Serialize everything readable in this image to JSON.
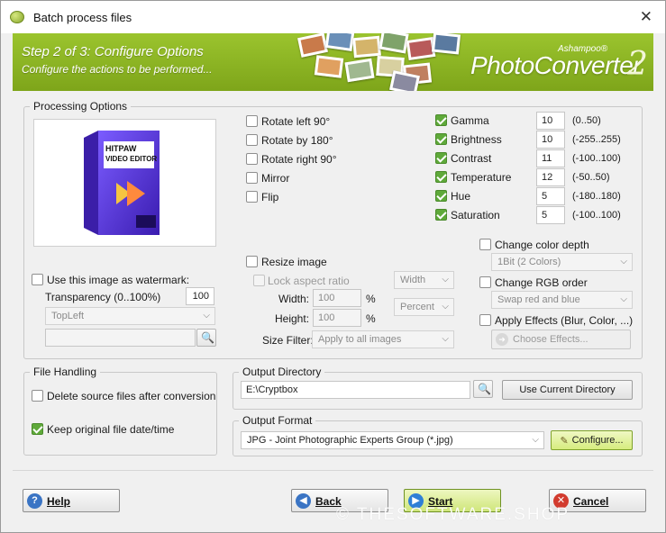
{
  "window": {
    "title": "Batch process files"
  },
  "banner": {
    "step": "Step 2 of 3: Configure Options",
    "subtitle": "Configure the actions to be performed...",
    "brand_small": "Ashampoo®",
    "brand_big": "PhotoConverter",
    "brand_num": "2"
  },
  "processing": {
    "legend": "Processing Options",
    "preview_product": {
      "line1": "HITPAW",
      "line2": "VIDEO EDITOR"
    },
    "watermark_label": "Use this image as watermark:",
    "transparency_label": "Transparency (0..100%)",
    "transparency_value": "100",
    "position_select": "TopLeft",
    "watermark_path": "",
    "rotate_left": "Rotate left 90°",
    "rotate_180": "Rotate by 180°",
    "rotate_right": "Rotate right 90°",
    "mirror": "Mirror",
    "flip": "Flip",
    "resize_label": "Resize image",
    "lock_aspect": "Lock aspect ratio",
    "dimension_select": "Width",
    "width_label": "Width:",
    "width_value": "100",
    "height_label": "Height:",
    "height_value": "100",
    "percent_sign": "%",
    "unit_select": "Percent",
    "size_filter_label": "Size Filter:",
    "size_filter_select": "Apply to all images",
    "adjustments": [
      {
        "label": "Gamma",
        "value": "10",
        "range": "(0..50)"
      },
      {
        "label": "Brightness",
        "value": "10",
        "range": "(-255..255)"
      },
      {
        "label": "Contrast",
        "value": "11",
        "range": "(-100..100)"
      },
      {
        "label": "Temperature",
        "value": "12",
        "range": "(-50..50)"
      },
      {
        "label": "Hue",
        "value": "5",
        "range": "(-180..180)"
      },
      {
        "label": "Saturation",
        "value": "5",
        "range": "(-100..100)"
      }
    ],
    "color_depth_label": "Change color depth",
    "color_depth_select": "1Bit (2 Colors)",
    "rgb_order_label": "Change RGB order",
    "rgb_order_select": "Swap red and blue",
    "effects_label": "Apply Effects (Blur, Color, ...)",
    "choose_effects": "Choose Effects..."
  },
  "file_handling": {
    "legend": "File Handling",
    "delete_source": "Delete source files after conversion",
    "keep_date": "Keep original file date/time"
  },
  "output_directory": {
    "legend": "Output Directory",
    "path": "E:\\Cryptbox",
    "use_current": "Use Current Directory"
  },
  "output_format": {
    "legend": "Output Format",
    "format": "JPG - Joint Photographic Experts Group (*.jpg)",
    "configure": "Configure..."
  },
  "footer": {
    "help": "Help",
    "back": "Back",
    "start": "Start",
    "cancel": "Cancel",
    "watermark_text": "© THESOFTWARE.SHOP"
  },
  "colors": {
    "accent_green": "#8ab426",
    "check_green": "#5fa93a",
    "help_blue": "#3a74c4",
    "back_blue": "#3a74c4",
    "start_blue": "#2f7fd6",
    "cancel_red": "#d23b2e"
  }
}
